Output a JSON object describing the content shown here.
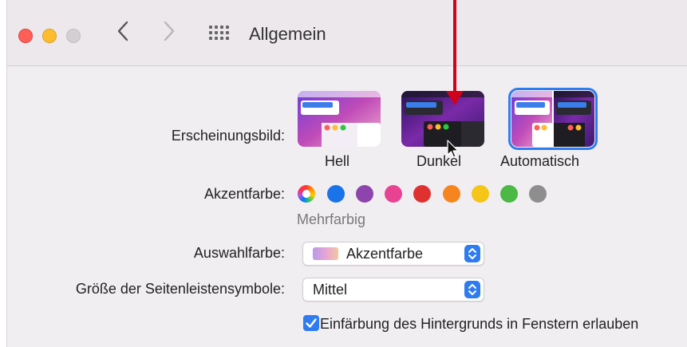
{
  "window": {
    "title": "Allgemein",
    "controls": {
      "close_color": "#ff5f57",
      "minimize_color": "#febc2e",
      "zoom_color": "#d3d0d3"
    }
  },
  "nav": {
    "back_icon": "chevron-left-icon",
    "forward_icon": "chevron-right-icon",
    "grid_icon": "grid-icon"
  },
  "appearance": {
    "label": "Erscheinungsbild:",
    "options": [
      {
        "label": "Hell",
        "selected": false
      },
      {
        "label": "Dunkel",
        "selected": false
      },
      {
        "label": "Automatisch",
        "selected": true
      }
    ]
  },
  "accent": {
    "label": "Akzentfarbe:",
    "selected_caption": "Mehrfarbig",
    "colors": [
      "multicolor",
      "#1a73e8",
      "#8e44ad",
      "#e84393",
      "#e03131",
      "#f7851f",
      "#f5c518",
      "#4cb944",
      "#8e8e8e"
    ]
  },
  "highlight": {
    "label": "Auswahlfarbe:",
    "value": "Akzentfarbe"
  },
  "sidebar_icon_size": {
    "label": "Größe der Seitenleistensymbole:",
    "value": "Mittel"
  },
  "tinting": {
    "label": "Einfärbung des Hintergrunds in Fenstern erlauben",
    "checked": true
  },
  "colors": {
    "accent": "#2f7cf0",
    "annotation_arrow": "#d0021b"
  }
}
